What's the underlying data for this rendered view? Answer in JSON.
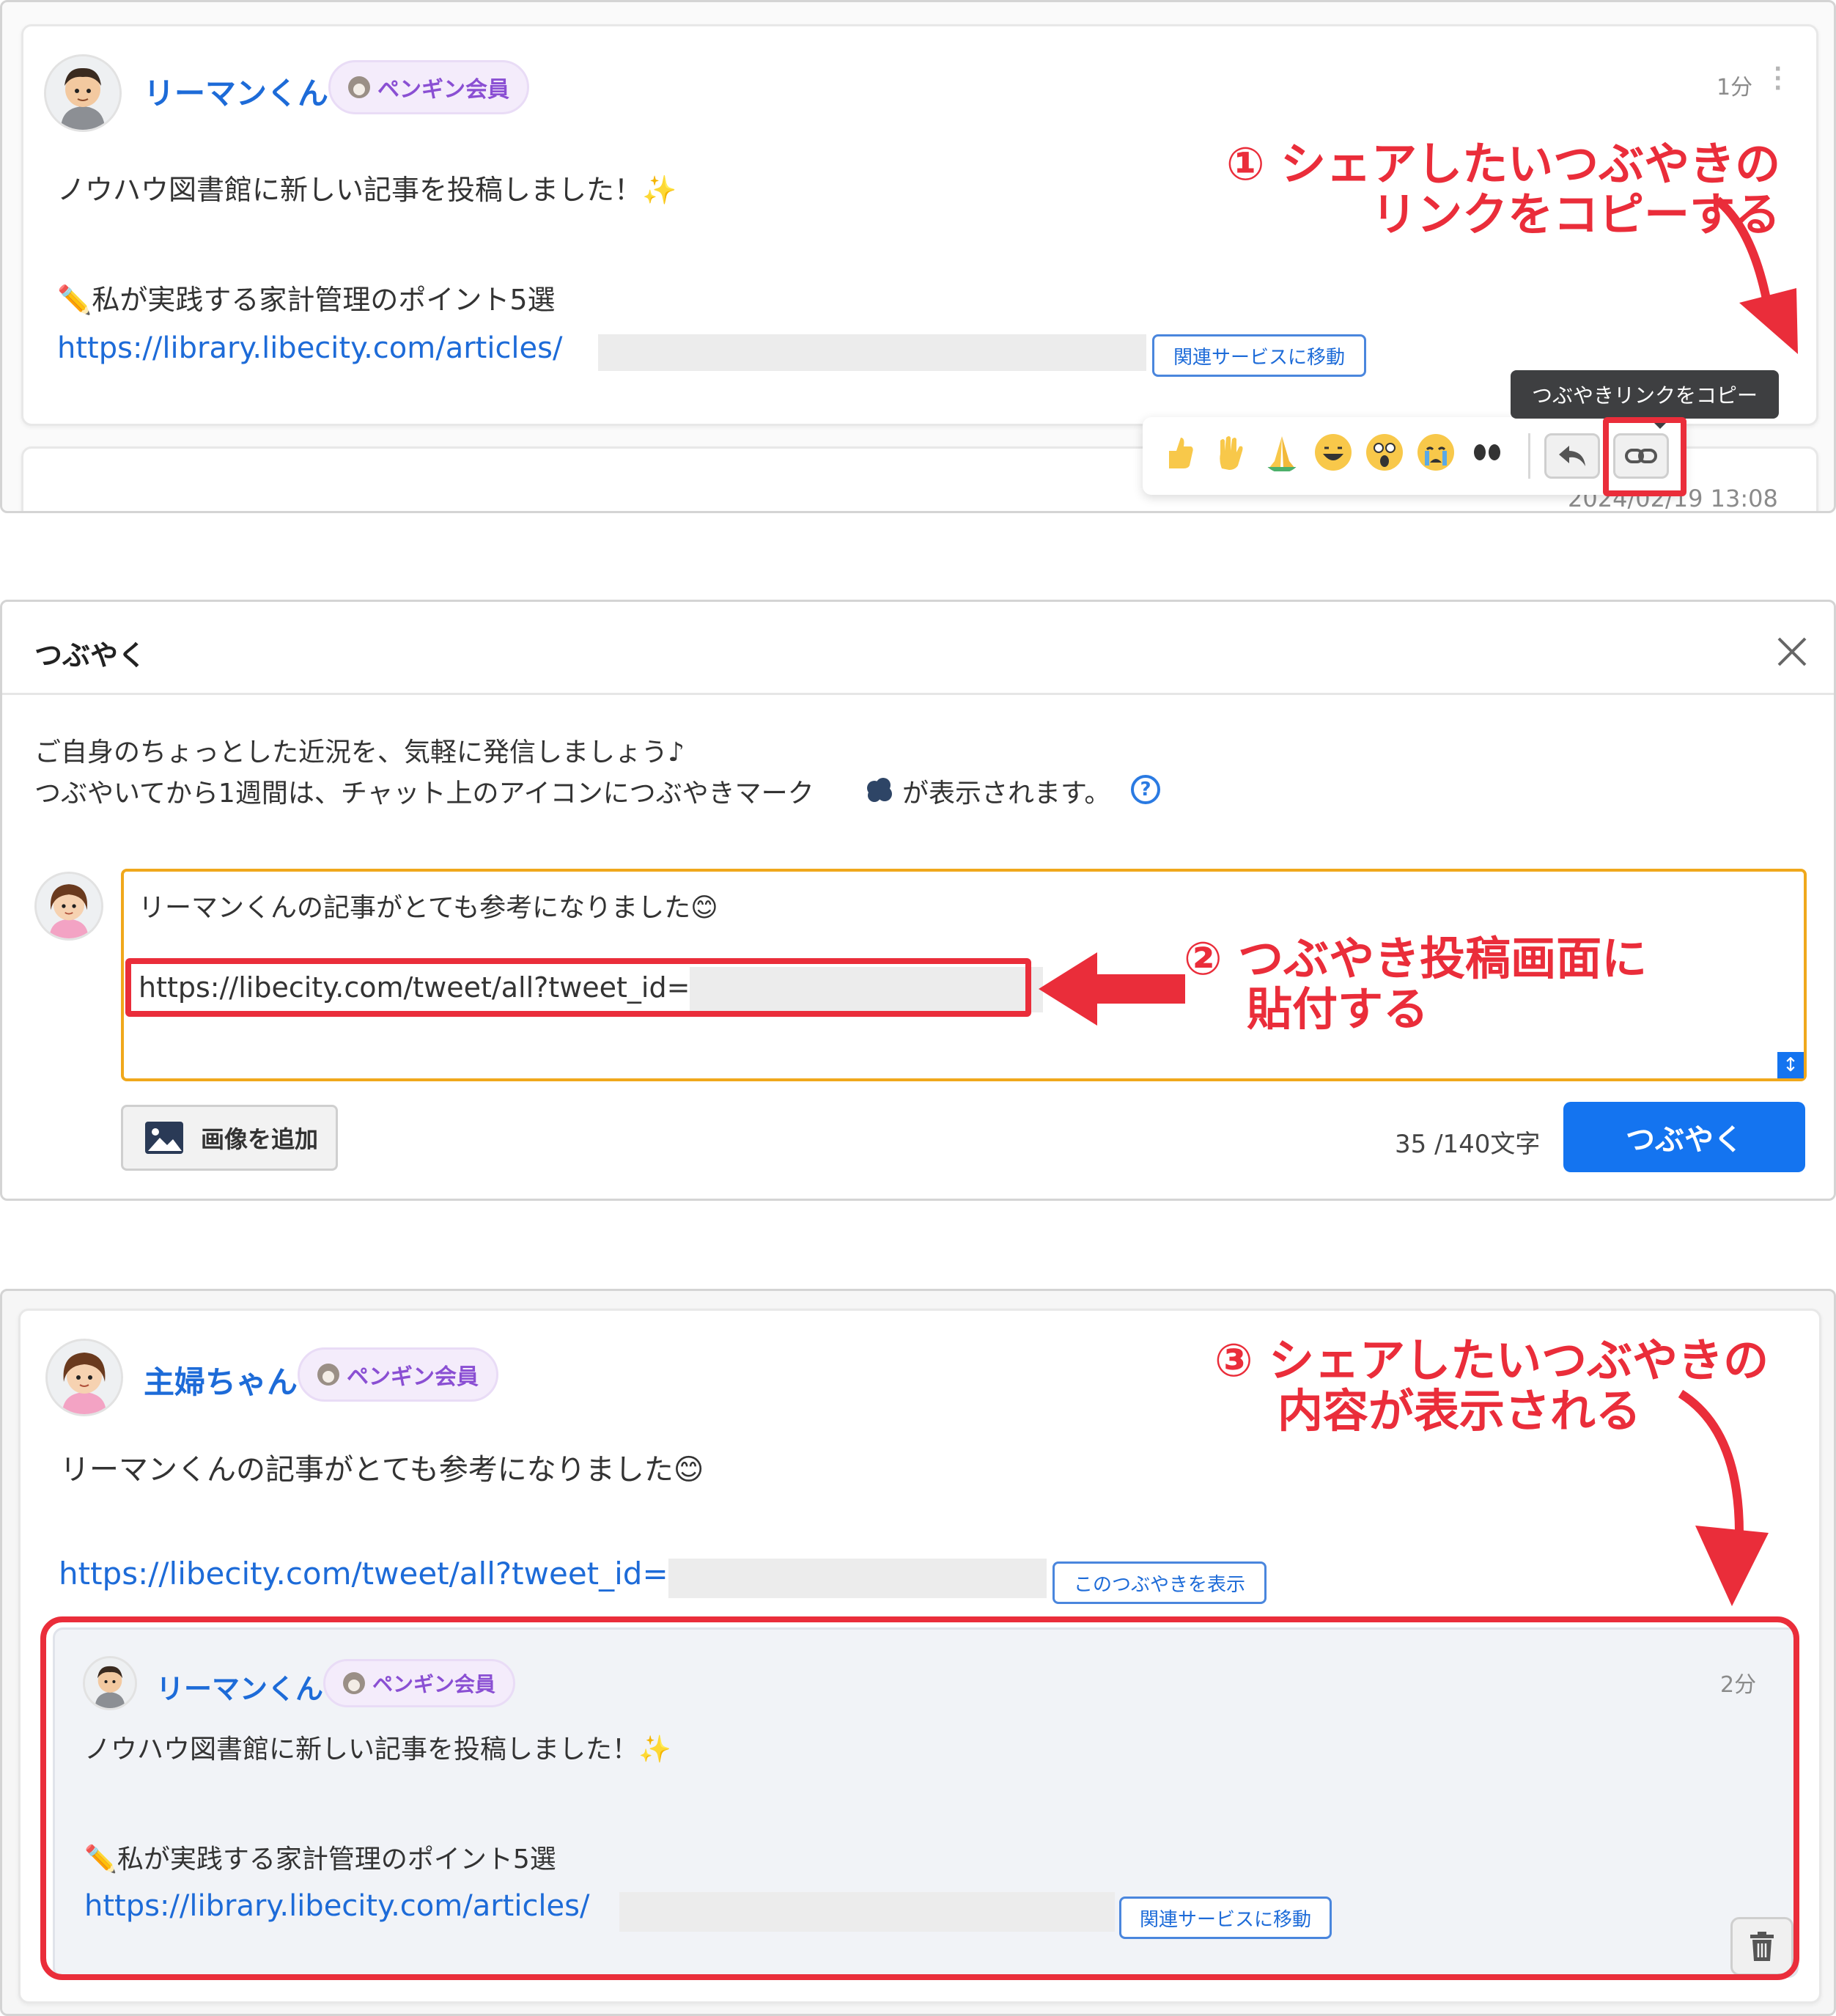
{
  "colors": {
    "accent_red": "#ea2d3a",
    "link_blue": "#1d6bd8",
    "submit_blue": "#1474f0",
    "badge_purple": "#8a4fd3",
    "textarea_orange": "#f0a81c"
  },
  "section1": {
    "post": {
      "username": "リーマンくん",
      "badge": "ペンギン会員",
      "time": "1分",
      "line1": "ノウハウ図書館に新しい記事を投稿しました！✨",
      "line2": "✏️私が実践する家計管理のポイント5選",
      "link": "https://library.libecity.com/articles/",
      "service_button": "関連サービスに移動"
    },
    "annotation": {
      "line1": "① シェアしたいつぶやきの",
      "line2": "リンクをコピーする"
    },
    "tooltip": "つぶやきリンクをコピー",
    "emoji_bar": {
      "emojis": [
        "thumbs-up",
        "raised-hand",
        "folded-hands",
        "grinning-face",
        "astonished-face",
        "crying-face",
        "eyes"
      ]
    },
    "next_post_date": "2024/02/19 13:08"
  },
  "section2": {
    "title": "つぶやく",
    "desc_line1": "ご自身のちょっとした近況を、気軽に発信しましょう♪",
    "desc_line2_a": "つぶやいてから1週間は、チャット上のアイコンにつぶやきマーク",
    "desc_line2_b": "が表示されます。",
    "help": "?",
    "draft_line1": "リーマンくんの記事がとても参考になりました😊",
    "draft_link": "https://libecity.com/tweet/all?tweet_id=",
    "annotation": {
      "line1": "② つぶやき投稿画面に",
      "line2": "貼付する"
    },
    "add_image": "画像を追加",
    "char_count": "35 /140文字",
    "submit": "つぶやく"
  },
  "section3": {
    "post": {
      "username": "主婦ちゃん",
      "badge": "ペンギン会員",
      "line1": "リーマンくんの記事がとても参考になりました😊",
      "link": "https://libecity.com/tweet/all?tweet_id=",
      "view_button": "このつぶやきを表示"
    },
    "annotation": {
      "line1": "③ シェアしたいつぶやきの",
      "line2": "内容が表示される"
    },
    "quoted": {
      "username": "リーマンくん",
      "badge": "ペンギン会員",
      "time": "2分",
      "line1": "ノウハウ図書館に新しい記事を投稿しました！✨",
      "line2": "✏️私が実践する家計管理のポイント5選",
      "link": "https://library.libecity.com/articles/",
      "service_button": "関連サービスに移動"
    }
  }
}
